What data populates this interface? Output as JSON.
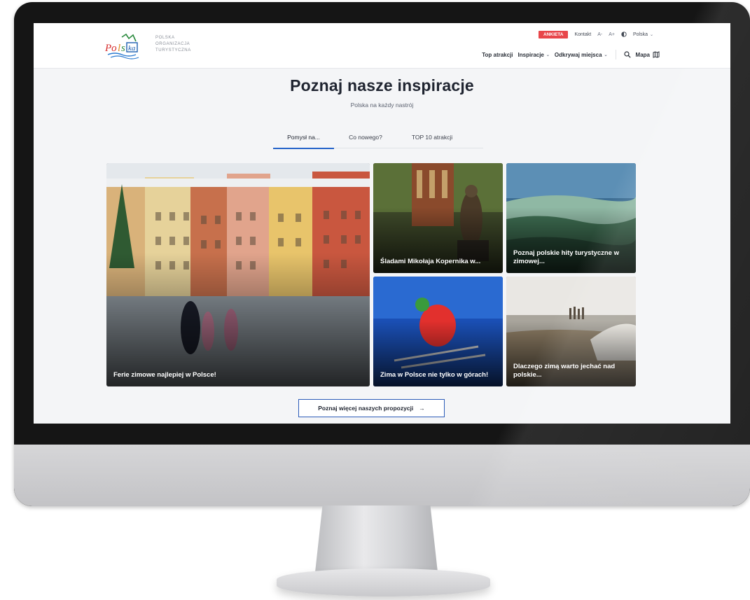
{
  "org": {
    "line1": "POLSKA",
    "line2": "ORGANIZACJA",
    "line3": "TURYSTYCZNA",
    "logo_text": "Polska"
  },
  "topbar": {
    "survey": "ANKIETA",
    "contact": "Kontakt",
    "font_smaller": "A-",
    "font_larger": "A+",
    "language": "Polska"
  },
  "nav": {
    "top": "Top atrakcji",
    "inspirations": "Inspiracje",
    "discover": "Odkrywaj miejsca",
    "map": "Mapa"
  },
  "hero": {
    "title": "Poznaj nasze inspiracje",
    "subtitle": "Polska na każdy nastrój"
  },
  "tabs": [
    {
      "label": "Pomysł na...",
      "active": true
    },
    {
      "label": "Co nowego?",
      "active": false
    },
    {
      "label": "TOP 10 atrakcji",
      "active": false
    }
  ],
  "cards": [
    {
      "title": "Ferie zimowe najlepiej w Polsce!"
    },
    {
      "title": "Śladami Mikołaja Kopernika w..."
    },
    {
      "title": "Poznaj polskie hity turystyczne w zimowej..."
    },
    {
      "title": "Zima w Polsce nie tylko w górach!"
    },
    {
      "title": "Dlaczego zimą warto jechać nad polskie..."
    }
  ],
  "more_button": "Poznaj więcej naszych propozycji",
  "colors": {
    "accent": "#2563c9",
    "survey": "#e8464a"
  }
}
